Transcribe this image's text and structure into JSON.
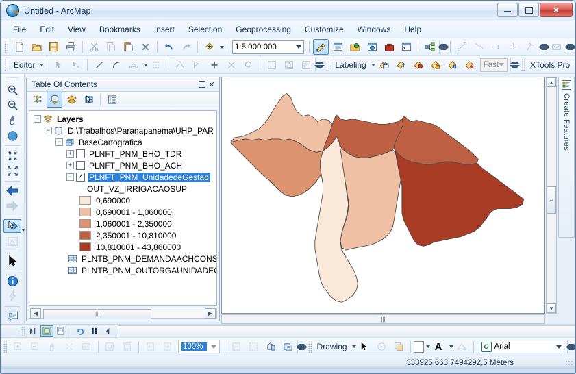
{
  "window": {
    "title": "Untitled - ArcMap",
    "app_icon": "arcmap-globe-icon",
    "minimize": "minimize-button",
    "maximize": "maximize-button",
    "close": "✕"
  },
  "menubar": {
    "items": [
      {
        "label": "File",
        "accel": "F"
      },
      {
        "label": "Edit",
        "accel": "E"
      },
      {
        "label": "View",
        "accel": "V"
      },
      {
        "label": "Bookmarks",
        "accel": "B"
      },
      {
        "label": "Insert",
        "accel": "I"
      },
      {
        "label": "Selection",
        "accel": "S"
      },
      {
        "label": "Geoprocessing",
        "accel": "G"
      },
      {
        "label": "Customize",
        "accel": "C"
      },
      {
        "label": "Windows",
        "accel": "W"
      },
      {
        "label": "Help",
        "accel": "H"
      }
    ]
  },
  "standard_toolbar": {
    "buttons": [
      "new-document",
      "open",
      "save",
      "print",
      "cut",
      "copy",
      "paste",
      "delete",
      "undo",
      "redo",
      "add-data"
    ],
    "scale": {
      "value": "1:5.000.000",
      "label": "map-scale-combo"
    },
    "right_buttons": [
      "editor-toolbar-toggle",
      "table-of-contents",
      "catalog-window",
      "search-window",
      "arctoolbox",
      "python-window",
      "model-builder"
    ]
  },
  "editor_toolbar": {
    "menu_label": "Editor",
    "tools": [
      "edit-tool",
      "edit-annotation-tool",
      "straight-segment",
      "end-point-arc",
      "trace",
      "sketch-properties",
      "construct-points",
      "split",
      "divide",
      "merge",
      "clip",
      "rotate",
      "attributes",
      "sketch-properties-table",
      "create-features-window"
    ]
  },
  "labeling_toolbar": {
    "menu_label": "Labeling",
    "tools": [
      "label-manager",
      "label-priority-ranking",
      "label-weight-ranking",
      "lock-labels",
      "pause-labeling",
      "view-unplaced-labels"
    ],
    "quality": {
      "value": "Fast",
      "label": "label-quality-combo"
    },
    "xtools_label": "XTools Pro"
  },
  "map_tools": {
    "buttons": [
      {
        "name": "zoom-in-tool",
        "label": "Zoom In"
      },
      {
        "name": "zoom-out-tool",
        "label": "Zoom Out"
      },
      {
        "name": "pan-tool",
        "label": "Pan"
      },
      {
        "name": "full-extent-tool",
        "label": "Full Extent"
      },
      {
        "name": "fixed-zoom-in-tool",
        "label": "Fixed Zoom In"
      },
      {
        "name": "fixed-zoom-out-tool",
        "label": "Fixed Zoom Out"
      },
      {
        "name": "go-back-extent",
        "label": "Go Back To Previous Extent"
      },
      {
        "name": "go-next-extent",
        "label": "Go To Next Extent"
      },
      {
        "name": "select-features-tool",
        "label": "Select Features",
        "active": true
      },
      {
        "name": "clear-selection-tool",
        "label": "Clear Selected Features"
      },
      {
        "name": "select-elements-tool",
        "label": "Select Elements"
      },
      {
        "name": "identify-tool",
        "label": "Identify"
      },
      {
        "name": "hyperlink-tool",
        "label": "Hyperlink"
      },
      {
        "name": "html-popup-tool",
        "label": "HTML Popup"
      }
    ]
  },
  "toc": {
    "title": "Table Of Contents",
    "restore_btn": "restore-button",
    "close_btn": "✕",
    "view_buttons": [
      {
        "name": "list-by-drawing-order",
        "active": false
      },
      {
        "name": "list-by-source",
        "active": true
      },
      {
        "name": "list-by-visibility",
        "active": false
      },
      {
        "name": "list-by-selection",
        "active": false
      },
      {
        "name": "toc-options",
        "active": false
      }
    ],
    "tree": {
      "root": {
        "label": "Layers",
        "expander": "−"
      },
      "workspace": {
        "label": "D:\\Trabalhos\\Paranapanema\\UHP_PAR",
        "expander": "−"
      },
      "dataset": {
        "label": "BaseCartografica",
        "expander": "−"
      },
      "layers": [
        {
          "label": "PLNFT_PNM_BHO_TDR",
          "expander": "+",
          "checked": false,
          "selected": false
        },
        {
          "label": "PLNFT_PNM_BHO_ACH",
          "expander": "+",
          "checked": false,
          "selected": false
        },
        {
          "label": "PLNFT_PNM_UnidadedeGestao",
          "expander": "−",
          "checked": true,
          "selected": true
        }
      ],
      "symbology_field": "OUT_VZ_IRRIGACAOSUP",
      "classes": [
        {
          "label": "0,690000",
          "color": "#FAE8D8"
        },
        {
          "label": "0,690001 - 1,060000",
          "color": "#EFC0A4"
        },
        {
          "label": "1,060001 - 2,350000",
          "color": "#DC9470"
        },
        {
          "label": "2,350001 - 10,810000",
          "color": "#BD6044"
        },
        {
          "label": "10,810001 - 43,860000",
          "color": "#A83C24"
        }
      ],
      "tables": [
        {
          "label": "PLNTB_PNM_DEMANDAACHCONS",
          "icon": "table-icon"
        },
        {
          "label": "PLNTB_PNM_OUTORGAUNIDADEGI",
          "icon": "table-icon"
        }
      ]
    },
    "hscroll": {
      "left": "◀",
      "right": "▶",
      "thumb": "|||"
    }
  },
  "map": {
    "name": "map-canvas",
    "background": "#FFFFFF",
    "outline_color": "#4d4d4d",
    "vscroll": {
      "up": "▲",
      "down": "▼",
      "thumb": "≡"
    },
    "hscroll": {
      "thumb": "|||"
    },
    "polygons": [
      {
        "name": "unidade-gestao-noroeste",
        "color": "#EFC0A4"
      },
      {
        "name": "unidade-gestao-oeste",
        "color": "#DC9470"
      },
      {
        "name": "unidade-gestao-norte",
        "color": "#BD6044"
      },
      {
        "name": "unidade-gestao-nordeste",
        "color": "#BD6044"
      },
      {
        "name": "unidade-gestao-central",
        "color": "#EFC0A4"
      },
      {
        "name": "unidade-gestao-sul",
        "color": "#FAE8D8"
      },
      {
        "name": "unidade-gestao-leste",
        "color": "#A83C24"
      }
    ]
  },
  "create_features_tab": {
    "label": "Create Features",
    "icon": "create-features-icon"
  },
  "view_bar": {
    "buttons": [
      {
        "name": "data-view-button",
        "active": true
      },
      {
        "name": "layout-view-button",
        "active": false
      },
      {
        "name": "refresh-view-button",
        "active": false
      },
      {
        "name": "pause-drawing-button",
        "active": false
      },
      {
        "name": "toggle-view-button",
        "active": false
      }
    ]
  },
  "layout_toolbar": {
    "buttons": [
      "zoom-in-page",
      "zoom-out-page",
      "pan-page",
      "zoom-whole-page",
      "zoom-100-percent",
      "fixed-zoom-in-page",
      "fixed-zoom-out-page",
      "go-back-page-extent",
      "go-forward-page-extent"
    ],
    "zoom": {
      "value": "100%",
      "label": "page-zoom-combo"
    },
    "extra": [
      "toggle-draft-mode",
      "focus-data-frame",
      "change-layout",
      "data-driven-pages"
    ]
  },
  "drawing_toolbar": {
    "menu_label": "Drawing",
    "tools": [
      "select-elements",
      "rotate-element",
      "new-rectangle",
      "fill-color",
      "font-color",
      "draw-order"
    ],
    "font": {
      "value": "Arial",
      "label": "font-family-combo",
      "icon": "opentype-icon"
    }
  },
  "statusbar": {
    "coordinates": "333925,663  7494292,5 Meters"
  }
}
